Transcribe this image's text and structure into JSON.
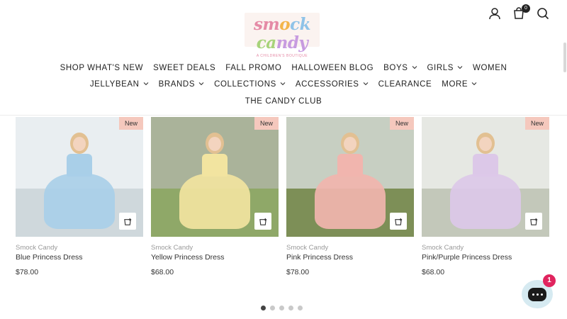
{
  "brand": {
    "logo_letters": [
      "sm",
      "o",
      "ck",
      " ca",
      "ndy"
    ],
    "logo_sub": "A CHILDREN'S BOUTIQUE"
  },
  "header": {
    "cart_count": "0",
    "icons": [
      "account-icon",
      "cart-icon",
      "search-icon"
    ]
  },
  "nav": {
    "row1": [
      {
        "label": "SHOP WHAT'S NEW",
        "dropdown": false
      },
      {
        "label": "SWEET DEALS",
        "dropdown": false
      },
      {
        "label": "FALL PROMO",
        "dropdown": false
      },
      {
        "label": "HALLOWEEN BLOG",
        "dropdown": false
      },
      {
        "label": "BOYS",
        "dropdown": true
      },
      {
        "label": "GIRLS",
        "dropdown": true
      },
      {
        "label": "WOMEN",
        "dropdown": false
      }
    ],
    "row2": [
      {
        "label": "JELLYBEAN",
        "dropdown": true
      },
      {
        "label": "BRANDS",
        "dropdown": true
      },
      {
        "label": "COLLECTIONS",
        "dropdown": true
      },
      {
        "label": "ACCESSORIES",
        "dropdown": true
      },
      {
        "label": "CLEARANCE",
        "dropdown": false
      },
      {
        "label": "MORE",
        "dropdown": true
      }
    ],
    "row3": [
      {
        "label": "THE CANDY CLUB",
        "dropdown": false
      }
    ]
  },
  "products": [
    {
      "badge": "New",
      "vendor": "Smock Candy",
      "title": "Blue Princess Dress",
      "price": "$78.00",
      "dress_color": "#a9cfe8",
      "sky": "#e9eef1",
      "ground": "#cfd8dc"
    },
    {
      "badge": "New",
      "vendor": "Smock Candy",
      "title": "Yellow Princess Dress",
      "price": "$68.00",
      "dress_color": "#f2e4a0",
      "sky": "#aab39a",
      "ground": "#8fa868"
    },
    {
      "badge": "New",
      "vendor": "Smock Candy",
      "title": "Pink Princess Dress",
      "price": "$78.00",
      "dress_color": "#f1b5ae",
      "sky": "#c7cfc2",
      "ground": "#7d8f57"
    },
    {
      "badge": "New",
      "vendor": "Smock Candy",
      "title": "Pink/Purple Princess Dress",
      "price": "$68.00",
      "dress_color": "#dcc8e8",
      "sky": "#e6e8e3",
      "ground": "#c3c8ba"
    }
  ],
  "carousel": {
    "dots": 5,
    "active": 0
  },
  "chat": {
    "badge": "1"
  },
  "colors": {
    "badge_bg": "#f5c8bd",
    "chat_bg": "#d6eaf1",
    "chat_badge": "#e0245e"
  }
}
